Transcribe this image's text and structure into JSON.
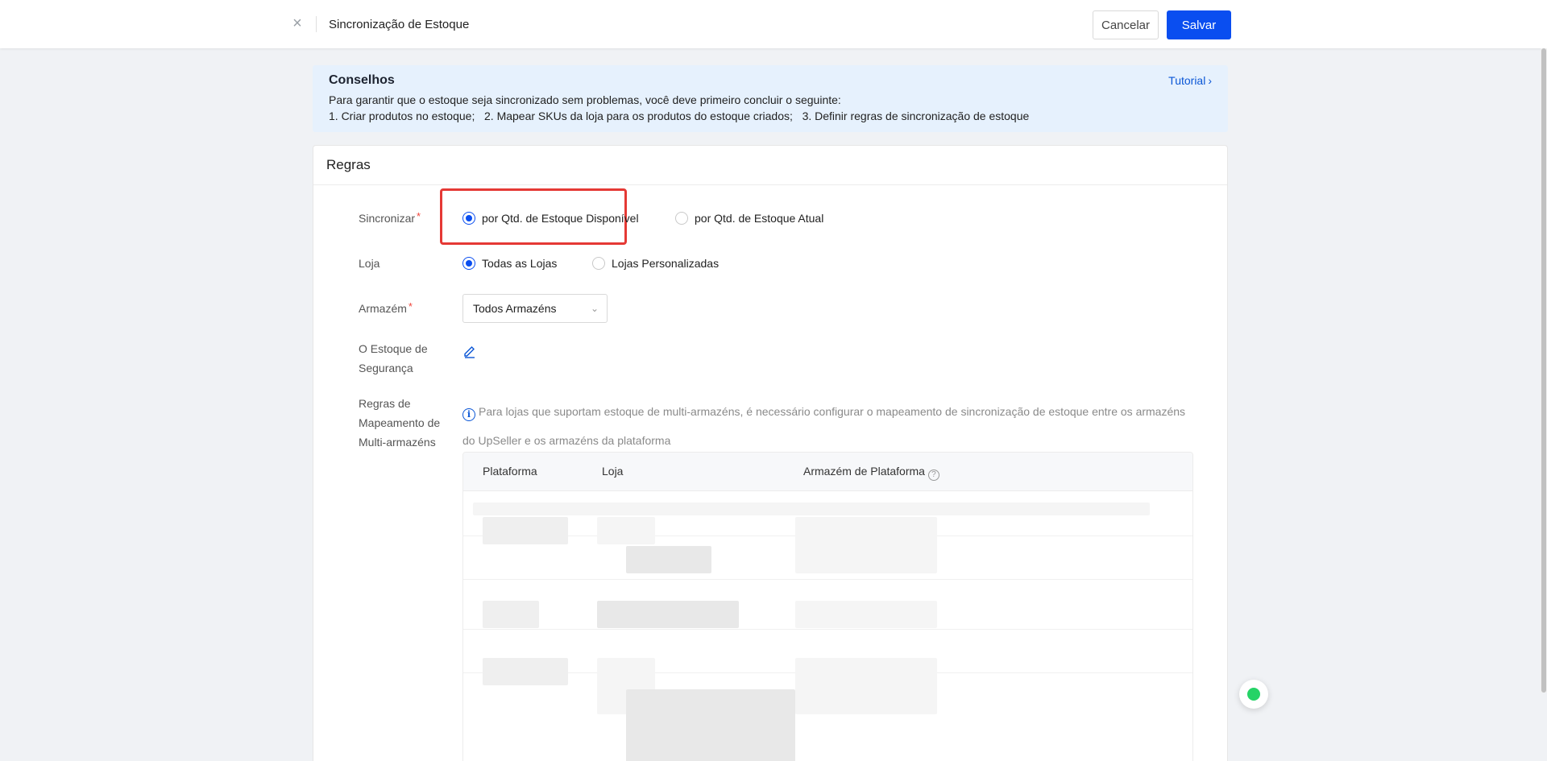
{
  "header": {
    "title": "Sincronização de Estoque",
    "cancel_label": "Cancelar",
    "save_label": "Salvar",
    "close_icon": "×"
  },
  "tips": {
    "title": "Conselhos",
    "line1": "Para garantir que o estoque seja sincronizado sem problemas, você deve primeiro concluir o seguinte:",
    "line2": "1. Criar produtos no estoque;   2. Mapear SKUs da loja para os produtos do estoque criados;   3. Definir regras de sincronização de estoque",
    "tutorial_label": "Tutorial",
    "tutorial_chevron": "›"
  },
  "rules": {
    "title": "Regras",
    "sync": {
      "label": "Sincronizar",
      "required_mark": "*",
      "options": [
        "por Qtd. de Estoque Disponível",
        "por Qtd. de Estoque Atual"
      ],
      "selected": 0
    },
    "store": {
      "label": "Loja",
      "options": [
        "Todas as Lojas",
        "Lojas Personalizadas"
      ],
      "selected": 0
    },
    "warehouse": {
      "label": "Armazém",
      "required_mark": "*",
      "value": "Todos Armazéns",
      "arrow": "⌄"
    },
    "safety_stock": {
      "label_line1": "O Estoque de",
      "label_line2": "Segurança",
      "icon": "edit-icon"
    },
    "mapping": {
      "label_line1": "Regras de",
      "label_line2": "Mapeamento de",
      "label_line3": "Multi-armazéns",
      "info_icon": "i",
      "info_text": "Para lojas que suportam estoque de multi-armazéns, é necessário configurar o mapeamento de sincronização de estoque entre os armazéns do UpSeller e os armazéns da plataforma",
      "columns": [
        "Plataforma",
        "Loja",
        "Armazém de Plataforma"
      ],
      "help_icon": "?"
    }
  },
  "colors": {
    "primary": "#0a4ef0",
    "highlight": "#e53935",
    "tips_bg": "#e6f1fd",
    "required": "#f0463c"
  }
}
